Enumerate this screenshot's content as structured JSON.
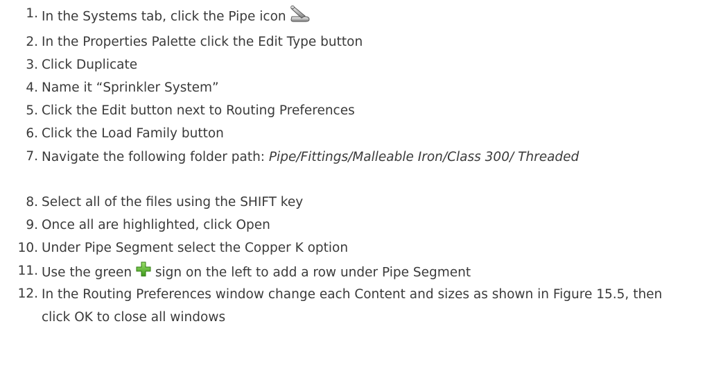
{
  "steps": [
    {
      "num": "1.",
      "parts": [
        "In the Systems tab, click the Pipe icon"
      ],
      "icon": "pipe-icon"
    },
    {
      "num": "2.",
      "parts": [
        "In the Properties Palette click the Edit Type button"
      ]
    },
    {
      "num": "3.",
      "parts": [
        "Click Duplicate"
      ]
    },
    {
      "num": "4.",
      "parts": [
        "Name it “Sprinkler System”"
      ]
    },
    {
      "num": "5.",
      "parts": [
        "Click the Edit button next to Routing Preferences"
      ]
    },
    {
      "num": "6.",
      "parts": [
        "Click the Load Family button"
      ]
    },
    {
      "num": "7.",
      "parts": [
        "Navigate the following folder path: ",
        "Pipe/Fittings/Malleable Iron/Class 300/ Threaded"
      ]
    },
    {
      "num": "8.",
      "parts": [
        "Select all of the files using the SHIFT key"
      ]
    },
    {
      "num": "9.",
      "parts": [
        "Once all are highlighted, click Open"
      ]
    },
    {
      "num": "10.",
      "parts": [
        "Under Pipe Segment select the Copper K option"
      ]
    },
    {
      "num": "11.",
      "parts": [
        "Use the green",
        "sign on the left to add a row under Pipe Segment"
      ],
      "icon": "green-plus-icon"
    },
    {
      "num": "12.",
      "parts": [
        "In the Routing Preferences window change each Content and sizes as shown in Figure 15.5, then click OK to close all windows"
      ]
    }
  ],
  "colors": {
    "text": "#3a3a3a",
    "plus_icon": "#5cb82e"
  }
}
